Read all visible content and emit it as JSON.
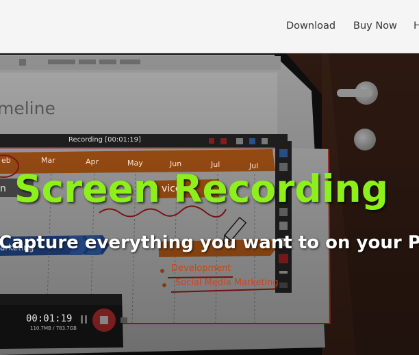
{
  "nav": {
    "links": [
      {
        "label": "Download"
      },
      {
        "label": "Buy Now"
      },
      {
        "label": "H"
      }
    ]
  },
  "hero": {
    "title": "Screen Recording",
    "subtitle": "nd Capture everything you want to on your PC",
    "title_color": "#8ef01b",
    "background": {
      "timeline_heading": "meline",
      "recording_label": "Recording [00:01:19]",
      "months": [
        "eb",
        "Mar",
        "Apr",
        "May",
        "Jun",
        "Jul",
        "Jul"
      ],
      "bar_text_left": "n",
      "bar_text_mid": "vice",
      "bar_text_blue": "arketing",
      "list_items": [
        "Development",
        "Social Media Marketing"
      ],
      "recorder_time": "00:01:19",
      "recorder_size": "110.7MB / 783.7GB"
    }
  }
}
